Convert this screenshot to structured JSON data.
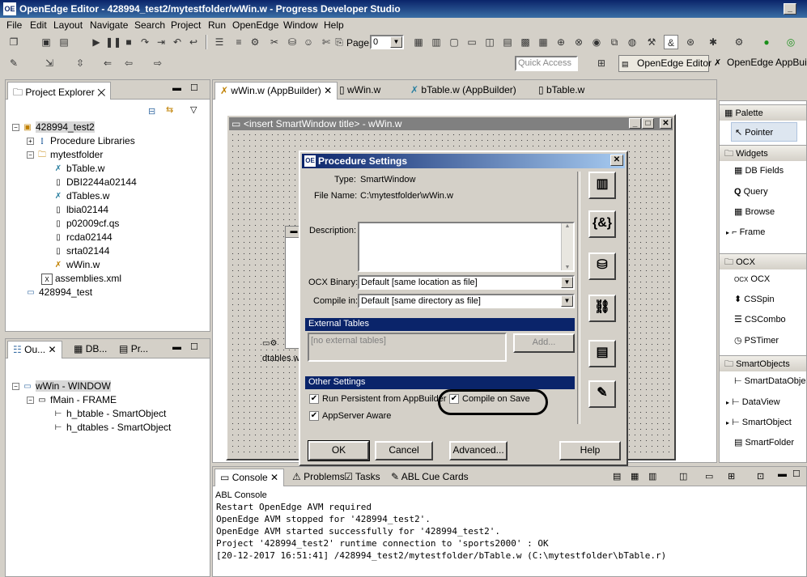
{
  "window": {
    "title": "OpenEdge Editor - 428994_test2/mytestfolder/wWin.w - Progress Developer Studio",
    "icon_text": "OE"
  },
  "menu": [
    "File",
    "Edit",
    "Layout",
    "Navigate",
    "Search",
    "Project",
    "Run",
    "OpenEdge",
    "Window",
    "Help"
  ],
  "toolbar": {
    "page_label": "Page",
    "page_value": "0",
    "quick_access_placeholder": "Quick Access",
    "perspectives": [
      "OpenEdge Editor",
      "OpenEdge AppBuilder"
    ]
  },
  "project_explorer": {
    "tab_label": "Project Explorer",
    "items": [
      {
        "label": "428994_test2"
      },
      {
        "label": "Procedure Libraries"
      },
      {
        "label": "mytestfolder"
      },
      {
        "label": "bTable.w"
      },
      {
        "label": "DBI2244a02144"
      },
      {
        "label": "dTables.w"
      },
      {
        "label": "lbia02144"
      },
      {
        "label": "p02009cf.qs"
      },
      {
        "label": "rcda02144"
      },
      {
        "label": "srta02144"
      },
      {
        "label": "wWin.w"
      },
      {
        "label": "assemblies.xml"
      },
      {
        "label": "428994_test"
      }
    ]
  },
  "outline": {
    "tabs": [
      "Ou...",
      "DB...",
      "Pr..."
    ],
    "items": [
      {
        "label": "wWin - WINDOW"
      },
      {
        "label": "fMain - FRAME"
      },
      {
        "label": "h_btable - SmartObject"
      },
      {
        "label": "h_dtables - SmartObject"
      }
    ]
  },
  "editor_tabs": [
    "wWin.w (AppBuilder)",
    "wWin.w",
    "bTable.w (AppBuilder)",
    "bTable.w"
  ],
  "design_window": {
    "title": "<insert SmartWindow title> - wWin.w",
    "object_label": "dtables.w"
  },
  "dialog": {
    "title": "Procedure Settings",
    "type_label": "Type:",
    "type_value": "SmartWindow",
    "filename_label": "File Name:",
    "filename_value": "C:\\mytestfolder\\wWin.w",
    "description_label": "Description:",
    "ocx_label": "OCX Binary:",
    "ocx_value": "Default [same location as file]",
    "compile_label": "Compile in:",
    "compile_value": "Default [same directory as file]",
    "external_tables_header": "External Tables",
    "external_tables_placeholder": "[no external tables]",
    "add_button": "Add...",
    "other_settings_header": "Other Settings",
    "run_persistent_label": "Run Persistent from AppBuilder",
    "compile_on_save_label": "Compile on Save",
    "appserver_aware_label": "AppServer Aware",
    "ok_button": "OK",
    "cancel_button": "Cancel",
    "advanced_button": "Advanced...",
    "help_button": "Help",
    "checks": {
      "run_persistent": true,
      "compile_on_save": true,
      "appserver_aware": true
    }
  },
  "palette": {
    "title": "Palette",
    "pointer": "Pointer",
    "groups": [
      {
        "name": "Widgets",
        "items": [
          "DB Fields",
          "Query",
          "Browse",
          "Frame"
        ]
      },
      {
        "name": "OCX",
        "items": [
          "OCX",
          "CSSpin",
          "CSCombo",
          "PSTimer"
        ]
      },
      {
        "name": "SmartObjects",
        "items": [
          "SmartDataObje",
          "DataView",
          "SmartObject",
          "SmartFolder"
        ]
      }
    ]
  },
  "console": {
    "tabs": [
      "Console",
      "Problems",
      "Tasks",
      "ABL Cue Cards"
    ],
    "subtitle": "ABL Console",
    "lines": [
      "Restart OpenEdge AVM required",
      "OpenEdge AVM stopped for '428994_test2'.",
      "OpenEdge AVM started successfully for '428994_test2'.",
      "Project '428994_test2' runtime connection to 'sports2000' : OK",
      "[20-12-2017 16:51:41] /428994_test2/mytestfolder/bTable.w (C:\\mytestfolder\\bTable.r)"
    ]
  }
}
